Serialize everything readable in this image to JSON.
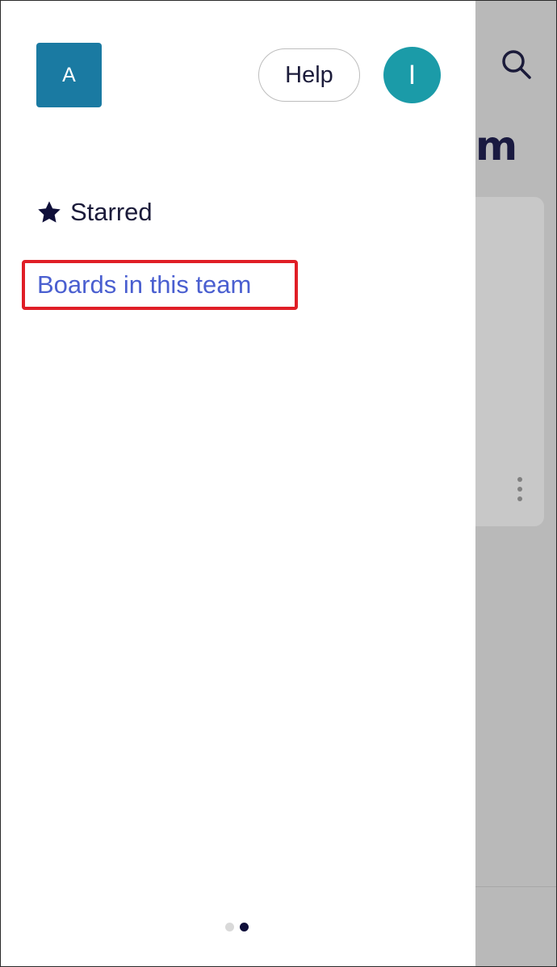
{
  "background": {
    "title_fragment": "m"
  },
  "header": {
    "workspace_initial": "A",
    "help_label": "Help",
    "avatar_initial": "I"
  },
  "nav": {
    "starred_label": "Starred",
    "boards_label": "Boards in this team"
  },
  "colors": {
    "workspace_tile": "#1a7aa2",
    "avatar": "#1b9ba8",
    "link": "#4a5fd0",
    "highlight": "#e01e26",
    "text": "#1b1b3a"
  },
  "pager": {
    "page_count": 2,
    "active_page": 2
  },
  "icons": {
    "search": "search-icon",
    "star": "star-icon",
    "more": "more-vertical-icon"
  }
}
